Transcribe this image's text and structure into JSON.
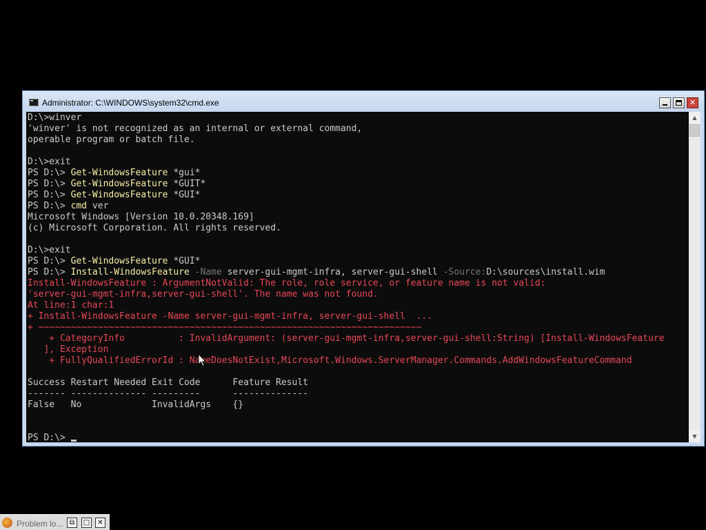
{
  "window": {
    "title": "Administrator: C:\\WINDOWS\\system32\\cmd.exe",
    "icon": "cmd-icon",
    "buttons": {
      "minimize": "minimize-icon",
      "maximize": "maximize-icon",
      "close": "✕"
    }
  },
  "colors": {
    "background": "#0c0c0c",
    "text": "#cccccc",
    "command": "#f9f1a5",
    "parameter": "#767676",
    "error": "#e74856"
  },
  "console": {
    "lines": [
      [
        {
          "t": "D:\\>winver",
          "c": "n"
        }
      ],
      [
        {
          "t": "'winver' is not recognized as an internal or external command,",
          "c": "n"
        }
      ],
      [
        {
          "t": "operable program or batch file.",
          "c": "n"
        }
      ],
      [],
      [
        {
          "t": "D:\\>exit",
          "c": "n"
        }
      ],
      [
        {
          "t": "PS D:\\> ",
          "c": "n"
        },
        {
          "t": "Get-WindowsFeature",
          "c": "cmd"
        },
        {
          "t": " *gui*",
          "c": "n"
        }
      ],
      [
        {
          "t": "PS D:\\> ",
          "c": "n"
        },
        {
          "t": "Get-WindowsFeature",
          "c": "cmd"
        },
        {
          "t": " *GUIT*",
          "c": "n"
        }
      ],
      [
        {
          "t": "PS D:\\> ",
          "c": "n"
        },
        {
          "t": "Get-WindowsFeature",
          "c": "cmd"
        },
        {
          "t": " *GUI*",
          "c": "n"
        }
      ],
      [
        {
          "t": "PS D:\\> ",
          "c": "n"
        },
        {
          "t": "cmd",
          "c": "cmd"
        },
        {
          "t": " ver",
          "c": "n"
        }
      ],
      [
        {
          "t": "Microsoft Windows [Version 10.0.20348.169]",
          "c": "n"
        }
      ],
      [
        {
          "t": "(c) Microsoft Corporation. All rights reserved.",
          "c": "n"
        }
      ],
      [],
      [
        {
          "t": "D:\\>exit",
          "c": "n"
        }
      ],
      [
        {
          "t": "PS D:\\> ",
          "c": "n"
        },
        {
          "t": "Get-WindowsFeature",
          "c": "cmd"
        },
        {
          "t": " *GUI*",
          "c": "n"
        }
      ],
      [
        {
          "t": "PS D:\\> ",
          "c": "n"
        },
        {
          "t": "Install-WindowsFeature",
          "c": "cmd"
        },
        {
          "t": " -Name",
          "c": "param"
        },
        {
          "t": " server-gui-mgmt-infra, server-gui-shell ",
          "c": "n"
        },
        {
          "t": "-Source:",
          "c": "param"
        },
        {
          "t": "D:\\sources\\install.wim",
          "c": "n"
        }
      ],
      [
        {
          "t": "Install-WindowsFeature : ArgumentNotValid: The role, role service, or feature name is not valid:",
          "c": "err"
        }
      ],
      [
        {
          "t": "'server-gui-mgmt-infra,server-gui-shell'. The name was not found.",
          "c": "err"
        }
      ],
      [
        {
          "t": "At line:1 char:1",
          "c": "err"
        }
      ],
      [
        {
          "t": "+ Install-WindowsFeature -Name server-gui-mgmt-infra, server-gui-shell  ...",
          "c": "err"
        }
      ],
      [
        {
          "t": "+ ~~~~~~~~~~~~~~~~~~~~~~~~~~~~~~~~~~~~~~~~~~~~~~~~~~~~~~~~~~~~~~~~~~~~~~~",
          "c": "err"
        }
      ],
      [
        {
          "t": "    + CategoryInfo          : InvalidArgument: (server-gui-mgmt-infra,server-gui-shell:String) [Install-WindowsFeature",
          "c": "err"
        }
      ],
      [
        {
          "t": "   ], Exception",
          "c": "err"
        }
      ],
      [
        {
          "t": "    + FullyQualifiedErrorId : NameDoesNotExist,Microsoft.Windows.ServerManager.Commands.AddWindowsFeatureCommand",
          "c": "err"
        }
      ],
      [],
      [
        {
          "t": "Success Restart Needed Exit Code      Feature Result",
          "c": "n"
        }
      ],
      [
        {
          "t": "------- -------------- ---------      --------------",
          "c": "n"
        }
      ],
      [
        {
          "t": "False   No             InvalidArgs    {}",
          "c": "n"
        }
      ],
      [],
      [],
      [
        {
          "t": "PS D:\\> ",
          "c": "n"
        }
      ]
    ]
  },
  "scrollbar": {
    "up": "▲",
    "down": "▼"
  },
  "taskbar": {
    "label": "Problem lo...",
    "icon": "firefox-icon",
    "restore": "⧉",
    "maximize": "□",
    "close": "✕"
  },
  "cursor": "arrow-cursor-icon"
}
